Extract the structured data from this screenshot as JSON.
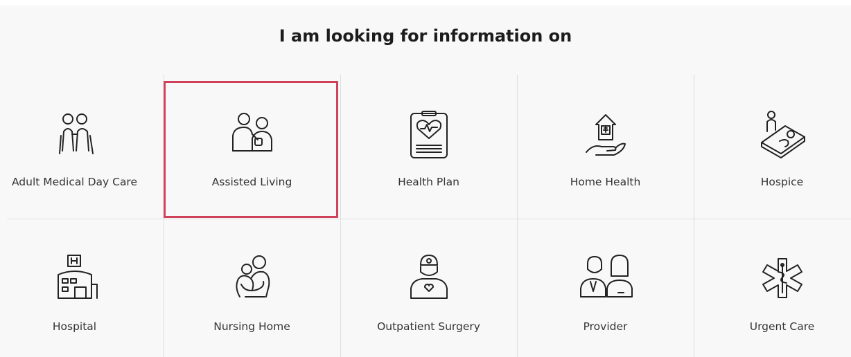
{
  "heading": "I am looking for information on",
  "accent_color": "#d0415b",
  "selected_tile": "Assisted Living",
  "tiles": [
    {
      "label": "Adult Medical Day Care",
      "icon": "elderly-couple-icon"
    },
    {
      "label": "Assisted Living",
      "icon": "caregiver-blood-pressure-icon"
    },
    {
      "label": "Health Plan",
      "icon": "clipboard-heart-icon"
    },
    {
      "label": "Home Health",
      "icon": "house-in-hand-icon"
    },
    {
      "label": "Hospice",
      "icon": "patient-in-bed-icon"
    },
    {
      "label": "Hospital",
      "icon": "hospital-building-icon"
    },
    {
      "label": "Nursing Home",
      "icon": "embracing-people-icon"
    },
    {
      "label": "Outpatient Surgery",
      "icon": "surgeon-icon"
    },
    {
      "label": "Provider",
      "icon": "doctors-icon"
    },
    {
      "label": "Urgent Care",
      "icon": "star-of-life-icon"
    }
  ]
}
